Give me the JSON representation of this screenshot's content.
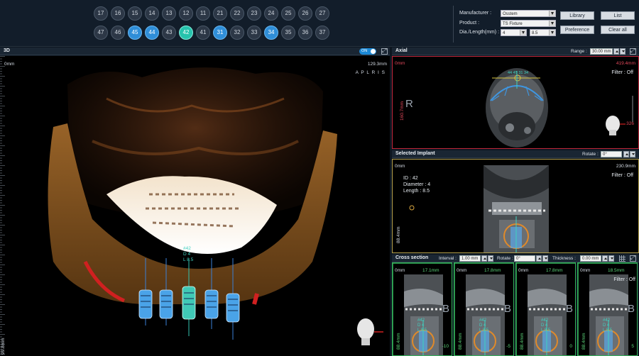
{
  "teeth": {
    "upper": [
      {
        "n": "17"
      },
      {
        "n": "16"
      },
      {
        "n": "15"
      },
      {
        "n": "14"
      },
      {
        "n": "13"
      },
      {
        "n": "12"
      },
      {
        "n": "11"
      },
      {
        "n": "21"
      },
      {
        "n": "22"
      },
      {
        "n": "23"
      },
      {
        "n": "24"
      },
      {
        "n": "25"
      },
      {
        "n": "26"
      },
      {
        "n": "27"
      }
    ],
    "lower": [
      {
        "n": "47"
      },
      {
        "n": "46"
      },
      {
        "n": "45",
        "state": "blue"
      },
      {
        "n": "44",
        "state": "blue"
      },
      {
        "n": "43"
      },
      {
        "n": "42",
        "state": "teal"
      },
      {
        "n": "41"
      },
      {
        "n": "31",
        "state": "blue"
      },
      {
        "n": "32"
      },
      {
        "n": "33"
      },
      {
        "n": "34",
        "state": "blue"
      },
      {
        "n": "35"
      },
      {
        "n": "36"
      },
      {
        "n": "37"
      }
    ]
  },
  "spec": {
    "manufacturer_label": "Manufacturer :",
    "manufacturer_value": "Osstem",
    "product_label": "Product :",
    "product_value": "TS Fixture",
    "dia_length_label": "Dia./Length(mm) :",
    "diameter_value": "4",
    "length_value": "8.5"
  },
  "buttons": {
    "library": "Library",
    "list": "List",
    "preference": "Preference",
    "clear_all": "Clear all"
  },
  "view3d": {
    "title": "3D",
    "toggle": "ON",
    "mm_top_left": "0mm",
    "mm_top_right": "129.3mm",
    "mm_bottom_left": "99.8mm",
    "orientation": "A P L R I S",
    "implant_label_id": "#42",
    "implant_label_d": "D 4",
    "implant_label_l": "L 8.5"
  },
  "axial": {
    "title": "Axial",
    "range_label": "Range :",
    "range_value": "30.00 mm",
    "mm_top_left": "0mm",
    "mm_top_right": "419.4mm",
    "mm_left": "160.7mm",
    "mm_right": "326",
    "filter": "Filter : Off",
    "side_marker": "R",
    "implant_numbers": [
      "44",
      "45",
      "31",
      "34"
    ]
  },
  "selected": {
    "title": "Selected Implant",
    "rotate_label": "Rotate :",
    "rotate_value": "0°",
    "mm_top_left": "0mm",
    "mm_top_right": "230.9mm",
    "mm_left": "88.4mm",
    "filter": "Filter : Off",
    "info_id": "ID : 42",
    "info_diameter": "Diameter : 4",
    "info_length": "Length : 8.5"
  },
  "cross": {
    "title": "Cross section",
    "interval_label": "Interval :",
    "interval_value": "1.00 mm",
    "rotate_label": "Rotate :",
    "rotate_value": "0°",
    "thickness_label": "Thickness :",
    "thickness_value": "0.00 mm",
    "filter": "Filter : Off",
    "columns": [
      {
        "top_left": "0mm",
        "top_right": "17.1mm",
        "left": "88.4mm",
        "id": "#42",
        "d": "D 4",
        "l": "L 8.5",
        "num": "-10",
        "letter": "B"
      },
      {
        "top_left": "0mm",
        "top_right": "17.8mm",
        "left": "88.4mm",
        "id": "#42",
        "d": "D 4",
        "l": "L 8.5",
        "num": "-5",
        "letter": "B"
      },
      {
        "top_left": "0mm",
        "top_right": "17.8mm",
        "left": "88.4mm",
        "id": "#42",
        "d": "D 4",
        "l": "L 8.5",
        "num": "0",
        "letter": "B"
      },
      {
        "top_left": "0mm",
        "top_right": "18.5mm",
        "left": "88.4mm",
        "id": "#42",
        "d": "D 4",
        "l": "L 8.5",
        "num": "5",
        "letter": "B"
      }
    ]
  },
  "colors": {
    "accent_blue": "#2f8ed8",
    "accent_teal": "#27c3ad",
    "axial_border": "#c0263a",
    "selected_border": "#b5a04a",
    "cross_border": "#33b25a"
  }
}
